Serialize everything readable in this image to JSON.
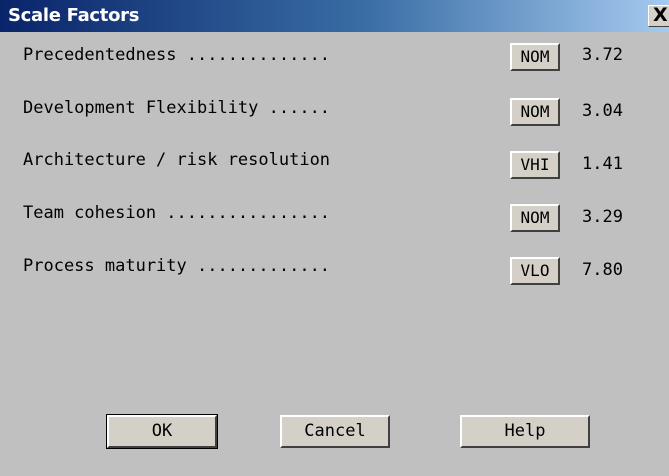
{
  "window": {
    "title": "Scale Factors",
    "close_glyph": "X",
    "close_icon": "close-icon"
  },
  "factors": [
    {
      "label": "Precedentedness ..............",
      "rating": "NOM",
      "value": "3.72"
    },
    {
      "label": "Development Flexibility ......",
      "rating": "NOM",
      "value": "3.04"
    },
    {
      "label": "Architecture / risk resolution",
      "rating": "VHI",
      "value": "1.41"
    },
    {
      "label": "Team cohesion ................",
      "rating": "NOM",
      "value": "3.29"
    },
    {
      "label": "Process maturity .............",
      "rating": "VLO",
      "value": "7.80"
    }
  ],
  "buttons": {
    "ok": "OK",
    "cancel": "Cancel",
    "help": "Help"
  },
  "colors": {
    "titlebar_start": "#0a246a",
    "titlebar_end": "#a6caf0",
    "face": "#c0c0c0"
  }
}
